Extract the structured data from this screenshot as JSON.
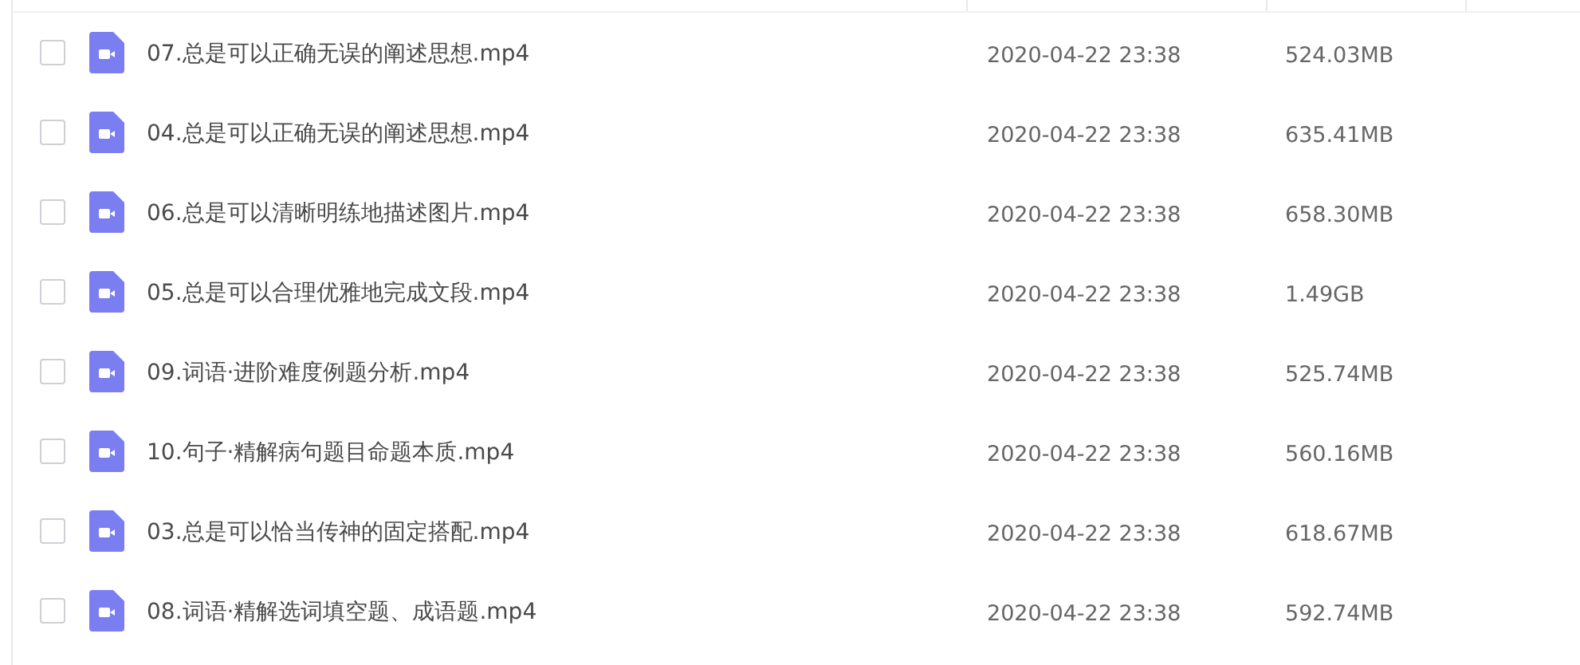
{
  "files": [
    {
      "name": "07.总是可以正确无误的阐述思想.mp4",
      "date": "2020-04-22 23:38",
      "size": "524.03MB",
      "checked": false
    },
    {
      "name": "04.总是可以正确无误的阐述思想.mp4",
      "date": "2020-04-22 23:38",
      "size": "635.41MB",
      "checked": false
    },
    {
      "name": "06.总是可以清晰明练地描述图片.mp4",
      "date": "2020-04-22 23:38",
      "size": "658.30MB",
      "checked": false
    },
    {
      "name": "05.总是可以合理优雅地完成文段.mp4",
      "date": "2020-04-22 23:38",
      "size": "1.49GB",
      "checked": false
    },
    {
      "name": "09.词语·进阶难度例题分析.mp4",
      "date": "2020-04-22 23:38",
      "size": "525.74MB",
      "checked": false
    },
    {
      "name": "10.句子·精解病句题目命题本质.mp4",
      "date": "2020-04-22 23:38",
      "size": "560.16MB",
      "checked": false
    },
    {
      "name": "03.总是可以恰当传神的固定搭配.mp4",
      "date": "2020-04-22 23:38",
      "size": "618.67MB",
      "checked": false
    },
    {
      "name": "08.词语·精解选词填空题、成语题.mp4",
      "date": "2020-04-22 23:38",
      "size": "592.74MB",
      "checked": false
    }
  ]
}
